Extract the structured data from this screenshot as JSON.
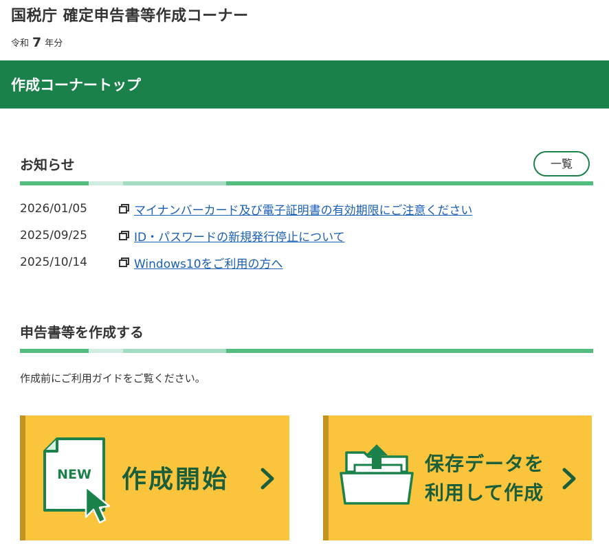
{
  "header": {
    "site_title": "国税庁 確定申告書等作成コーナー",
    "era_prefix": "令和",
    "era_year": "7",
    "era_suffix": "年分"
  },
  "banner": {
    "title": "作成コーナートップ"
  },
  "notices": {
    "heading": "お知らせ",
    "list_button": "一覧",
    "items": [
      {
        "date": "2026/01/05",
        "text": "マイナンバーカード及び電子証明書の有効期限にご注意ください"
      },
      {
        "date": "2025/09/25",
        "text": "ID・パスワードの新規発行停止について"
      },
      {
        "date": "2025/10/14",
        "text": "Windows10をご利用の方へ"
      }
    ]
  },
  "create": {
    "heading": "申告書等を作成する",
    "intro": "作成前にご利用ガイドをご覧ください。",
    "start_card": {
      "badge": "NEW",
      "label": "作成開始"
    },
    "saved_card": {
      "label_line1": "保存データを",
      "label_line2": "利用して作成"
    }
  },
  "colors": {
    "brand_green": "#1b814a",
    "accent_green": "#52bd7f",
    "card_yellow": "#fbc43d",
    "link_blue": "#1a5fb4"
  }
}
